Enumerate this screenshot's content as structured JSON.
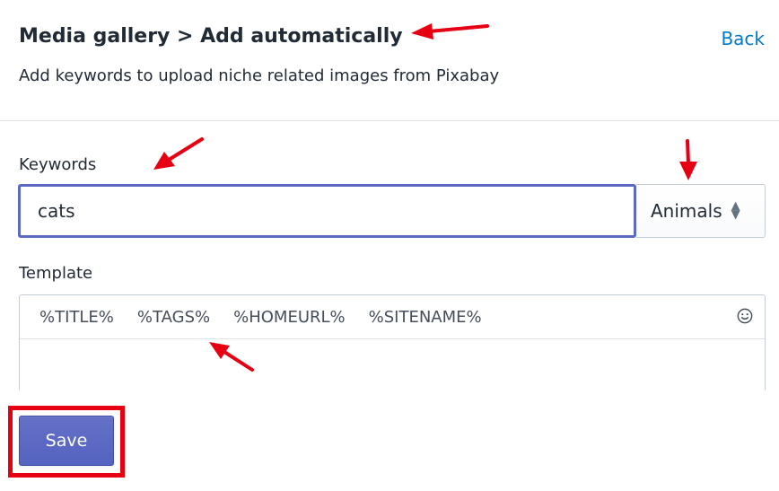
{
  "header": {
    "title": "Media gallery > Add automatically",
    "back_label": "Back",
    "subtitle": "Add keywords to upload niche related images from Pixabay"
  },
  "keywords": {
    "label": "Keywords",
    "value": "cats",
    "category_selected": "Animals"
  },
  "template": {
    "label": "Template",
    "tags": [
      "%TITLE%",
      "%TAGS%",
      "%HOMEURL%",
      "%SITENAME%"
    ],
    "value": ""
  },
  "actions": {
    "save_label": "Save"
  },
  "colors": {
    "accent": "#5c6ac4",
    "link": "#007ace",
    "annotation": "#e60012"
  },
  "icons": [
    "emoji-icon",
    "select-chevron-icon"
  ]
}
